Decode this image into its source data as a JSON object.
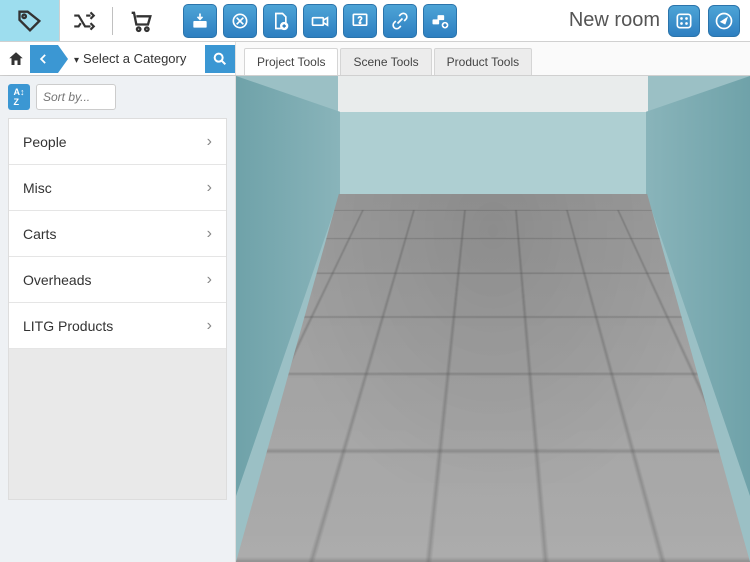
{
  "top": {
    "new_room": "New room",
    "icons": {
      "tag": "tag-icon",
      "shuffle": "shuffle-icon",
      "cart": "cart-icon",
      "tool1": "save-icon",
      "tool2": "undo-icon",
      "tool3": "add-page-icon",
      "tool4": "camera-icon",
      "tool5": "help-icon",
      "tool6": "link-icon",
      "tool7": "blocks-add-icon",
      "dice": "dice-icon",
      "compass": "compass-icon"
    }
  },
  "second": {
    "select_category": "Select a Category",
    "tabs": [
      {
        "label": "Project Tools",
        "active": true
      },
      {
        "label": "Scene Tools",
        "active": false
      },
      {
        "label": "Product Tools",
        "active": false
      }
    ]
  },
  "sidebar": {
    "sort_placeholder": "Sort by...",
    "categories": [
      {
        "label": "People"
      },
      {
        "label": "Misc"
      },
      {
        "label": "Carts"
      },
      {
        "label": "Overheads"
      },
      {
        "label": "LITG Products"
      }
    ]
  }
}
